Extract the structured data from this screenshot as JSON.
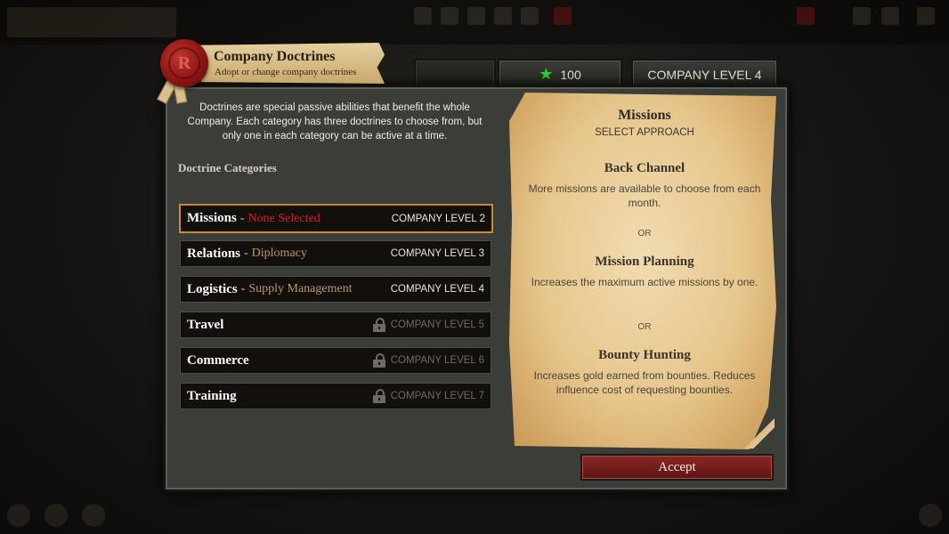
{
  "header": {
    "title": "Company Doctrines",
    "subtitle": "Adopt or change company doctrines"
  },
  "top_tabs": {
    "currency_icon": "star-icon",
    "currency_value": "100",
    "company_level": "COMPANY LEVEL 4"
  },
  "intro_text": "Doctrines are special passive abilities that benefit the whole Company. Each category has three doctrines to choose from, but only one in each category can be active at a time.",
  "categories_heading": "Doctrine Categories",
  "categories": [
    {
      "name": "Missions",
      "status": "None Selected",
      "level": "COMPANY LEVEL 2",
      "locked": false,
      "selected": true
    },
    {
      "name": "Relations",
      "status": "Diplomacy",
      "level": "COMPANY LEVEL 3",
      "locked": false,
      "selected": false
    },
    {
      "name": "Logistics",
      "status": "Supply Management",
      "level": "COMPANY LEVEL 4",
      "locked": false,
      "selected": false
    },
    {
      "name": "Travel",
      "status": "",
      "level": "COMPANY LEVEL 5",
      "locked": true,
      "selected": false
    },
    {
      "name": "Commerce",
      "status": "",
      "level": "COMPANY LEVEL 6",
      "locked": true,
      "selected": false
    },
    {
      "name": "Training",
      "status": "",
      "level": "COMPANY LEVEL 7",
      "locked": true,
      "selected": false
    }
  ],
  "detail": {
    "title": "Missions",
    "subtitle": "SELECT APPROACH",
    "or_label": "OR",
    "options": [
      {
        "name": "Back Channel",
        "description": "More missions are available to choose from each month."
      },
      {
        "name": "Mission Planning",
        "description": "Increases the maximum active missions by one."
      },
      {
        "name": "Bounty Hunting",
        "description": "Increases gold earned from bounties. Reduces influence cost of requesting bounties."
      }
    ]
  },
  "accept_label": "Accept",
  "colors": {
    "panel": "#3b3d39",
    "selected_border": "#cf8a25",
    "none_selected": "#d3251f",
    "doctrine_name": "#b69a68",
    "accept_button": "#7a2321",
    "parchment": "#e6c68c"
  }
}
